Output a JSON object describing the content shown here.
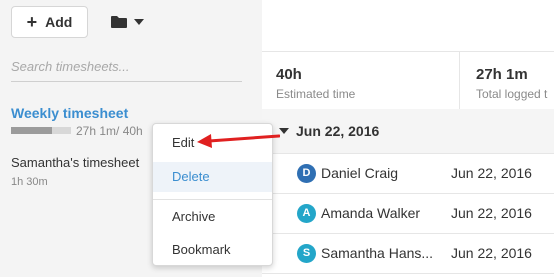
{
  "toolbar": {
    "add_label": "Add",
    "plus_glyph": "+"
  },
  "search": {
    "placeholder": "Search timesheets..."
  },
  "timesheets": [
    {
      "title": "Weekly timesheet",
      "meta": "27h 1m/ 40h",
      "progress": 0.675
    },
    {
      "title": "Samantha's timesheet",
      "meta": "1h 30m"
    }
  ],
  "stats": {
    "estimated_value": "40h",
    "estimated_label": "Estimated time",
    "logged_value": "27h 1m",
    "logged_label": "Total logged t"
  },
  "date_group": {
    "label": "Jun 22, 2016"
  },
  "rows": [
    {
      "initial": "D",
      "name": "Daniel Craig",
      "date": "Jun 22, 2016",
      "color": "#2f6fb3"
    },
    {
      "initial": "A",
      "name": "Amanda Walker",
      "date": "Jun 22, 2016",
      "color": "#23a6c9"
    },
    {
      "initial": "S",
      "name": "Samantha Hans...",
      "date": "Jun 22, 2016",
      "color": "#23a6c9"
    }
  ],
  "context_menu": {
    "items": [
      {
        "label": "Edit"
      },
      {
        "label": "Delete"
      },
      {
        "label": "Archive"
      },
      {
        "label": "Bookmark"
      }
    ]
  },
  "colors": {
    "accent": "#3b8ed0",
    "annotation_arrow": "#e02020",
    "panel_bg": "#f4f4f4"
  },
  "icons": {
    "add": "plus-icon",
    "folder": "folder-icon",
    "dropdown": "caret-down-icon"
  }
}
